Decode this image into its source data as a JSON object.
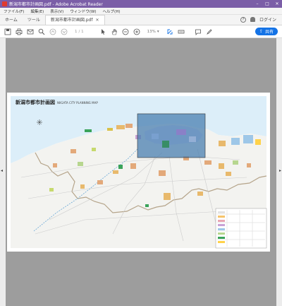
{
  "window": {
    "title": "新潟市都市計画図.pdf - Adobe Acrobat Reader",
    "controls": [
      "–",
      "□",
      "✕"
    ]
  },
  "menu": [
    "ファイル(F)",
    "編集(E)",
    "表示(V)",
    "ウィンドウ(W)",
    "ヘルプ(H)"
  ],
  "tabs": [
    {
      "label": "ホーム"
    },
    {
      "label": "ツール"
    },
    {
      "label": "新潟市都市計画図.pdf",
      "active": true
    }
  ],
  "header_right": {
    "help_icon": "question-icon",
    "bell_icon": "bell-icon",
    "signin_label": "ログイン"
  },
  "toolbar": {
    "page_current": "1",
    "page_total": "/ 1",
    "zoom": "13%",
    "share_label": "共有"
  },
  "document": {
    "map_title": "新潟市都市計画図",
    "map_subtitle": "NIIGATA CITY PLANNING MAP"
  },
  "colors": {
    "titlebar": "#7b5ea7",
    "accent_blue": "#1473e6",
    "sea": "#dceef9",
    "highlight": "#4a7fb0"
  }
}
